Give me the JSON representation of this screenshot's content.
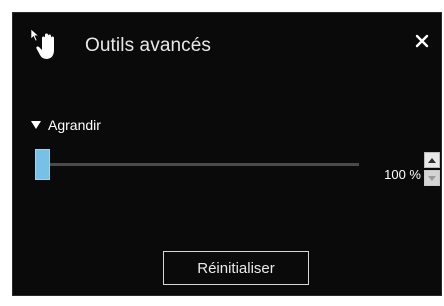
{
  "panel": {
    "title": "Outils avancés",
    "icon": "hand-pointer-icon",
    "close_icon": "close-icon"
  },
  "section": {
    "label": "Agrandir",
    "expanded": true
  },
  "zoom": {
    "value_text": "100 %",
    "level": 0.0
  },
  "spinner": {
    "up_icon": "arrow-up-icon",
    "down_icon": "arrow-down-icon"
  },
  "reset_button": {
    "label": "Réinitialiser"
  },
  "colors": {
    "panel_background": "#0a0a0a",
    "slider_accent": "#78c1e6",
    "text": "#eaeaea"
  }
}
